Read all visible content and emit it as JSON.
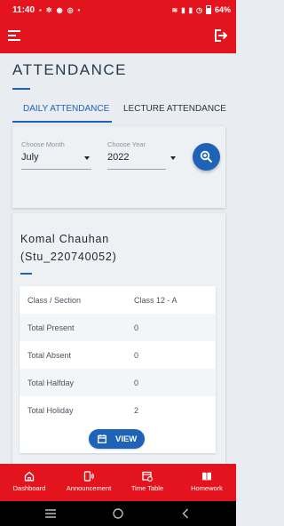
{
  "status_bar": {
    "time": "11:40",
    "left_icons": [
      "sim-icon",
      "settings-icon",
      "messenger-icon",
      "whatsapp-icon",
      "dot-icon"
    ],
    "battery": "64%"
  },
  "app_bar": {
    "menu_icon": "hamburger-icon",
    "logout_icon": "logout-icon",
    "color": "#e3141d"
  },
  "page": {
    "title": "ATTENDANCE"
  },
  "tabs": [
    {
      "label": "DAILY ATTENDANCE",
      "active": true
    },
    {
      "label": "LECTURE ATTENDANCE",
      "active": false
    }
  ],
  "filters": {
    "month": {
      "label": "Choose Month",
      "value": "July"
    },
    "year": {
      "label": "Choose Year",
      "value": "2022"
    },
    "search_icon": "zoom-in-icon"
  },
  "student": {
    "name": "Komal Chauhan",
    "id": "(Stu_220740052)"
  },
  "summary": [
    {
      "label": "Class / Section",
      "value": "Class 12 - A"
    },
    {
      "label": "Total Present",
      "value": "0"
    },
    {
      "label": "Total Absent",
      "value": "0"
    },
    {
      "label": "Total Halfday",
      "value": "0"
    },
    {
      "label": "Total Holiday",
      "value": "2"
    }
  ],
  "view_button": {
    "label": "VIEW",
    "icon": "calendar-icon"
  },
  "bottom_nav": [
    {
      "label": "Dashboard",
      "icon": "home-icon"
    },
    {
      "label": "Announcement",
      "icon": "announcement-icon"
    },
    {
      "label": "Time Table",
      "icon": "timetable-icon"
    },
    {
      "label": "Homework",
      "icon": "book-icon"
    }
  ],
  "system_nav": [
    "recents-icon",
    "home-circle-icon",
    "back-icon"
  ],
  "colors": {
    "primary_red": "#e3141d",
    "accent_blue": "#1f63b8"
  }
}
